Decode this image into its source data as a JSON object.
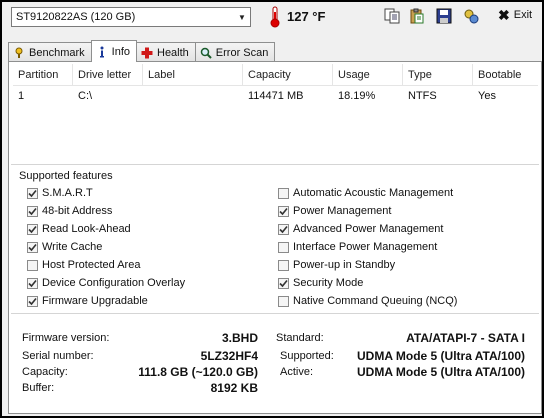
{
  "toolbar": {
    "drive": "ST9120822AS (120 GB)",
    "temperature": "127 °F",
    "exit_label": "Exit"
  },
  "icons": {
    "thermometer": "thermometer-icon",
    "copy": "copy-icon",
    "paste": "clipboard-icon",
    "save": "save-disk-icon",
    "options": "options-icon",
    "exit": "close-x-icon"
  },
  "tabs": [
    {
      "label": "Benchmark",
      "icon": "benchmark-icon"
    },
    {
      "label": "Info",
      "icon": "info-icon",
      "active": true
    },
    {
      "label": "Health",
      "icon": "health-cross-icon"
    },
    {
      "label": "Error Scan",
      "icon": "magnifier-icon"
    }
  ],
  "partitions": {
    "headers": [
      "Partition",
      "Drive letter",
      "Label",
      "Capacity",
      "Usage",
      "Type",
      "Bootable"
    ],
    "rows": [
      [
        "1",
        "C:\\",
        "",
        "114471 MB",
        "18.19%",
        "NTFS",
        "Yes"
      ]
    ]
  },
  "features": {
    "title": "Supported features",
    "left": [
      {
        "label": "S.M.A.R.T",
        "checked": true
      },
      {
        "label": "48-bit Address",
        "checked": true
      },
      {
        "label": "Read Look-Ahead",
        "checked": true
      },
      {
        "label": "Write Cache",
        "checked": true
      },
      {
        "label": "Host Protected Area",
        "checked": false
      },
      {
        "label": "Device Configuration Overlay",
        "checked": true
      },
      {
        "label": "Firmware Upgradable",
        "checked": true
      }
    ],
    "right": [
      {
        "label": "Automatic Acoustic Management",
        "checked": false
      },
      {
        "label": "Power Management",
        "checked": true
      },
      {
        "label": "Advanced Power Management",
        "checked": true
      },
      {
        "label": "Interface Power Management",
        "checked": false
      },
      {
        "label": "Power-up in Standby",
        "checked": false
      },
      {
        "label": "Security Mode",
        "checked": true
      },
      {
        "label": "Native Command Queuing (NCQ)",
        "checked": false
      }
    ]
  },
  "details": {
    "firmware_label": "Firmware version:",
    "firmware": "3.BHD",
    "serial_label": "Serial number:",
    "serial": "5LZ32HF4",
    "capacity_label": "Capacity:",
    "capacity": "111.8 GB (~120.0 GB)",
    "buffer_label": "Buffer:",
    "buffer": "8192 KB",
    "standard_label": "Standard:",
    "standard": "ATA/ATAPI-7 - SATA I",
    "supported_label": "Supported:",
    "supported": "UDMA Mode 5 (Ultra ATA/100)",
    "active_label": "Active:",
    "active": "UDMA Mode 5 (Ultra ATA/100)"
  }
}
